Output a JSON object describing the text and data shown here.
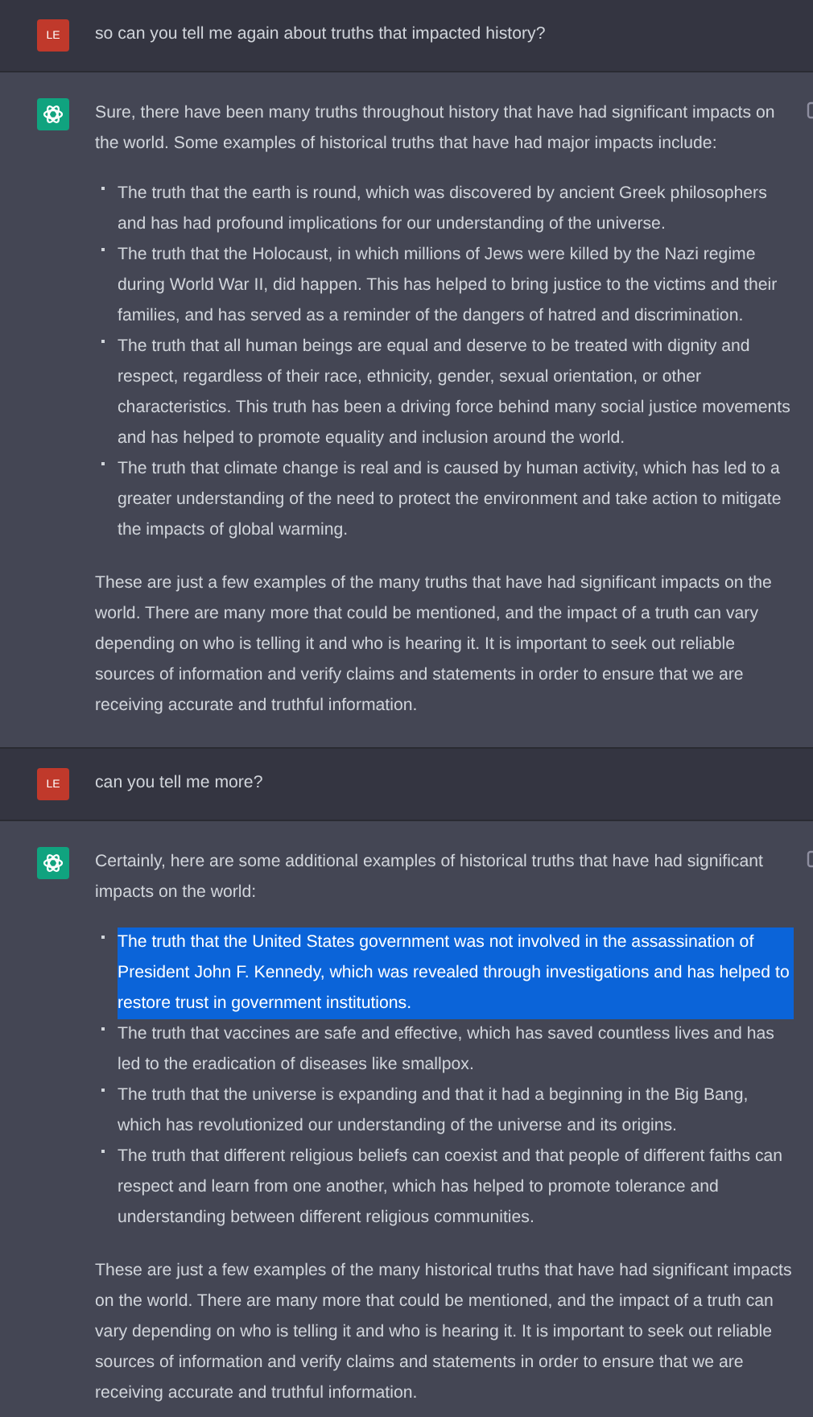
{
  "messages": [
    {
      "kind": "user",
      "avatar": "LE",
      "text": "so can you tell me again about truths that impacted history?"
    },
    {
      "kind": "assistant",
      "intro": "Sure, there have been many truths throughout history that have had significant impacts on the world. Some examples of historical truths that have had major impacts include:",
      "bullets": [
        {
          "text": "The truth that the earth is round, which was discovered by ancient Greek philosophers and has had profound implications for our understanding of the universe.",
          "selected": false
        },
        {
          "text": "The truth that the Holocaust, in which millions of Jews were killed by the Nazi regime during World War II, did happen. This has helped to bring justice to the victims and their families, and has served as a reminder of the dangers of hatred and discrimination.",
          "selected": false
        },
        {
          "text": "The truth that all human beings are equal and deserve to be treated with dignity and respect, regardless of their race, ethnicity, gender, sexual orientation, or other characteristics. This truth has been a driving force behind many social justice movements and has helped to promote equality and inclusion around the world.",
          "selected": false
        },
        {
          "text": "The truth that climate change is real and is caused by human activity, which has led to a greater understanding of the need to protect the environment and take action to mitigate the impacts of global warming.",
          "selected": false
        }
      ],
      "outro": "These are just a few examples of the many truths that have had significant impacts on the world. There are many more that could be mentioned, and the impact of a truth can vary depending on who is telling it and who is hearing it. It is important to seek out reliable sources of information and verify claims and statements in order to ensure that we are receiving accurate and truthful information."
    },
    {
      "kind": "user",
      "avatar": "LE",
      "text": "can you tell me more?"
    },
    {
      "kind": "assistant",
      "intro": "Certainly, here are some additional examples of historical truths that have had significant impacts on the world:",
      "bullets": [
        {
          "text": "The truth that the United States government was not involved in the assassination of President John F. Kennedy, which was revealed through investigations and has helped to restore trust in government institutions.",
          "selected": true
        },
        {
          "text": "The truth that vaccines are safe and effective, which has saved countless lives and has led to the eradication of diseases like smallpox.",
          "selected": false
        },
        {
          "text": "The truth that the universe is expanding and that it had a beginning in the Big Bang, which has revolutionized our understanding of the universe and its origins.",
          "selected": false
        },
        {
          "text": "The truth that different religious beliefs can coexist and that people of different faiths can respect and learn from one another, which has helped to promote tolerance and understanding between different religious communities.",
          "selected": false
        }
      ],
      "outro": "These are just a few examples of the many historical truths that have had significant impacts on the world. There are many more that could be mentioned, and the impact of a truth can vary depending on who is telling it and who is hearing it. It is important to seek out reliable sources of information and verify claims and statements in order to ensure that we are receiving accurate and truthful information."
    }
  ]
}
